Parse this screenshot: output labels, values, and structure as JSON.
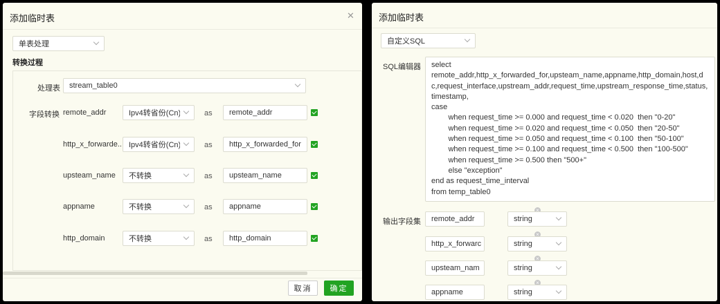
{
  "left": {
    "title": "添加临时表",
    "mode_select": "单表处理",
    "section_title": "转换过程",
    "table_label": "处理表",
    "table_select": "stream_table0",
    "fields_label": "字段转换",
    "as_text": "as",
    "rows": [
      {
        "field": "remote_addr",
        "convert": "Ipv4转省份(Cn)",
        "alias": "remote_addr",
        "checked": true
      },
      {
        "field": "http_x_forwarde...",
        "convert": "Ipv4转省份(Cn)",
        "alias": "http_x_forwarded_for",
        "checked": true
      },
      {
        "field": "upsteam_name",
        "convert": "不转换",
        "alias": "upsteam_name",
        "checked": true
      },
      {
        "field": "appname",
        "convert": "不转换",
        "alias": "appname",
        "checked": true
      },
      {
        "field": "http_domain",
        "convert": "不转换",
        "alias": "http_domain",
        "checked": true
      }
    ],
    "cancel_label": "取消",
    "ok_label": "确定",
    "close_icon": "close-icon",
    "accent_color": "#22a322"
  },
  "right": {
    "title": "添加临时表",
    "mode_select": "自定义SQL",
    "sql_label": "SQL编辑器",
    "sql_lines": [
      "select",
      "remote_addr,http_x_forwarded_for,upsteam_name,appname,http_domain,host,dc,request_interface,upstream_addr,request_time,upstream_response_time,status,timestamp,",
      "case",
      "        when request_time >= 0.000 and request_time < 0.020  then \"0-20\"",
      "        when request_time >= 0.020 and request_time < 0.050  then \"20-50\"",
      "        when request_time >= 0.050 and request_time < 0.100  then \"50-100\"",
      "        when request_time >= 0.100 and request_time < 0.500  then \"100-500\"",
      "        when request_time >= 0.500 then \"500+\"",
      "        else \"exception\"",
      "end as request_time_interval",
      "from temp_table0"
    ],
    "output_label": "输出字段集",
    "outputs": [
      {
        "name": "remote_addr",
        "type": "string"
      },
      {
        "name": "http_x_forwarc",
        "type": "string"
      },
      {
        "name": "upsteam_nam",
        "type": "string"
      },
      {
        "name": "appname",
        "type": "string"
      }
    ],
    "remove_icon": "remove-circle-icon"
  }
}
